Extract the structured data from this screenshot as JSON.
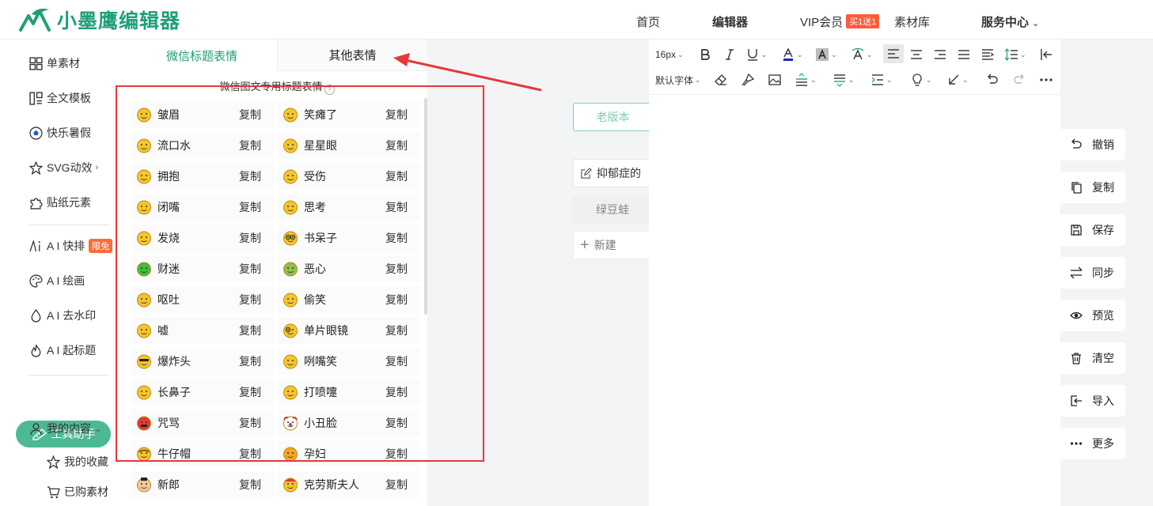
{
  "header": {
    "logo_text": "小墨鹰编辑器",
    "nav": [
      {
        "label": "首页"
      },
      {
        "label": "编辑器"
      },
      {
        "label": "VIP会员",
        "badge": "买1送1"
      },
      {
        "label": "素材库"
      },
      {
        "label": "服务中心"
      }
    ]
  },
  "sidebar": {
    "items": [
      {
        "label": "单素材",
        "icon": "grid-icon"
      },
      {
        "label": "全文模板",
        "icon": "layout-icon"
      },
      {
        "label": "快乐暑假",
        "icon": "soccer-ball-icon"
      },
      {
        "label": "SVG动效",
        "icon": "star-outline-icon"
      },
      {
        "label": "贴纸元素",
        "icon": "puzzle-icon"
      },
      {
        "label": "A I 快排",
        "icon": "ai-icon",
        "badge": "限免"
      },
      {
        "label": "A I 绘画",
        "icon": "palette-icon"
      },
      {
        "label": "A I 去水印",
        "icon": "droplet-icon"
      },
      {
        "label": "A I 起标题",
        "icon": "flame-icon"
      }
    ],
    "tool_button": "工具助手",
    "my_content": "我的内容",
    "sub_items": [
      {
        "label": "我的收藏",
        "icon": "star-outline-icon"
      },
      {
        "label": "已购素材",
        "icon": "cart-icon"
      }
    ]
  },
  "panel": {
    "tabs": [
      "微信标题表情",
      "其他表情"
    ],
    "title": "微信图文专用标题表情",
    "copy_label": "复制",
    "rows": [
      [
        {
          "name": "皱眉",
          "emoji": "frown"
        },
        {
          "name": "笑瘫了",
          "emoji": "rofl"
        }
      ],
      [
        {
          "name": "流口水",
          "emoji": "drool"
        },
        {
          "name": "星星眼",
          "emoji": "star-eyes"
        }
      ],
      [
        {
          "name": "拥抱",
          "emoji": "hug"
        },
        {
          "name": "受伤",
          "emoji": "hurt"
        }
      ],
      [
        {
          "name": "闭嘴",
          "emoji": "zipper"
        },
        {
          "name": "思考",
          "emoji": "think"
        }
      ],
      [
        {
          "name": "发烧",
          "emoji": "fever"
        },
        {
          "name": "书呆子",
          "emoji": "nerd"
        }
      ],
      [
        {
          "name": "财迷",
          "emoji": "money"
        },
        {
          "name": "恶心",
          "emoji": "nausea"
        }
      ],
      [
        {
          "name": "呕吐",
          "emoji": "vomit"
        },
        {
          "name": "偷笑",
          "emoji": "giggle"
        }
      ],
      [
        {
          "name": "嘘",
          "emoji": "shush"
        },
        {
          "name": "单片眼镜",
          "emoji": "monocle"
        }
      ],
      [
        {
          "name": "爆炸头",
          "emoji": "explode"
        },
        {
          "name": "咧嘴笑",
          "emoji": "grin"
        }
      ],
      [
        {
          "name": "长鼻子",
          "emoji": "lie"
        },
        {
          "name": "打喷嚏",
          "emoji": "sneeze"
        }
      ],
      [
        {
          "name": "咒骂",
          "emoji": "curse"
        },
        {
          "name": "小丑脸",
          "emoji": "clown"
        }
      ],
      [
        {
          "name": "牛仔帽",
          "emoji": "cowboy"
        },
        {
          "name": "孕妇",
          "emoji": "pregnant"
        }
      ],
      [
        {
          "name": "新郎",
          "emoji": "groom"
        },
        {
          "name": "克劳斯夫人",
          "emoji": "mrs-claus"
        }
      ]
    ]
  },
  "middle": {
    "old_version": "老版本",
    "docs": [
      "抑郁症的",
      "绿豆蛙"
    ],
    "new_label": "新建"
  },
  "editor": {
    "font_size": "16px",
    "font_family": "默认字体"
  },
  "actions": [
    {
      "label": "撤销",
      "icon": "undo-icon"
    },
    {
      "label": "复制",
      "icon": "copy-icon"
    },
    {
      "label": "保存",
      "icon": "save-icon"
    },
    {
      "label": "同步",
      "icon": "sync-icon"
    },
    {
      "label": "预览",
      "icon": "eye-icon"
    },
    {
      "label": "清空",
      "icon": "trash-icon"
    },
    {
      "label": "导入",
      "icon": "import-icon"
    },
    {
      "label": "更多",
      "icon": "more-icon"
    }
  ],
  "colors": {
    "brand": "#1f9f78",
    "annotation": "#e5383b",
    "badge": "#ff5b3a"
  }
}
